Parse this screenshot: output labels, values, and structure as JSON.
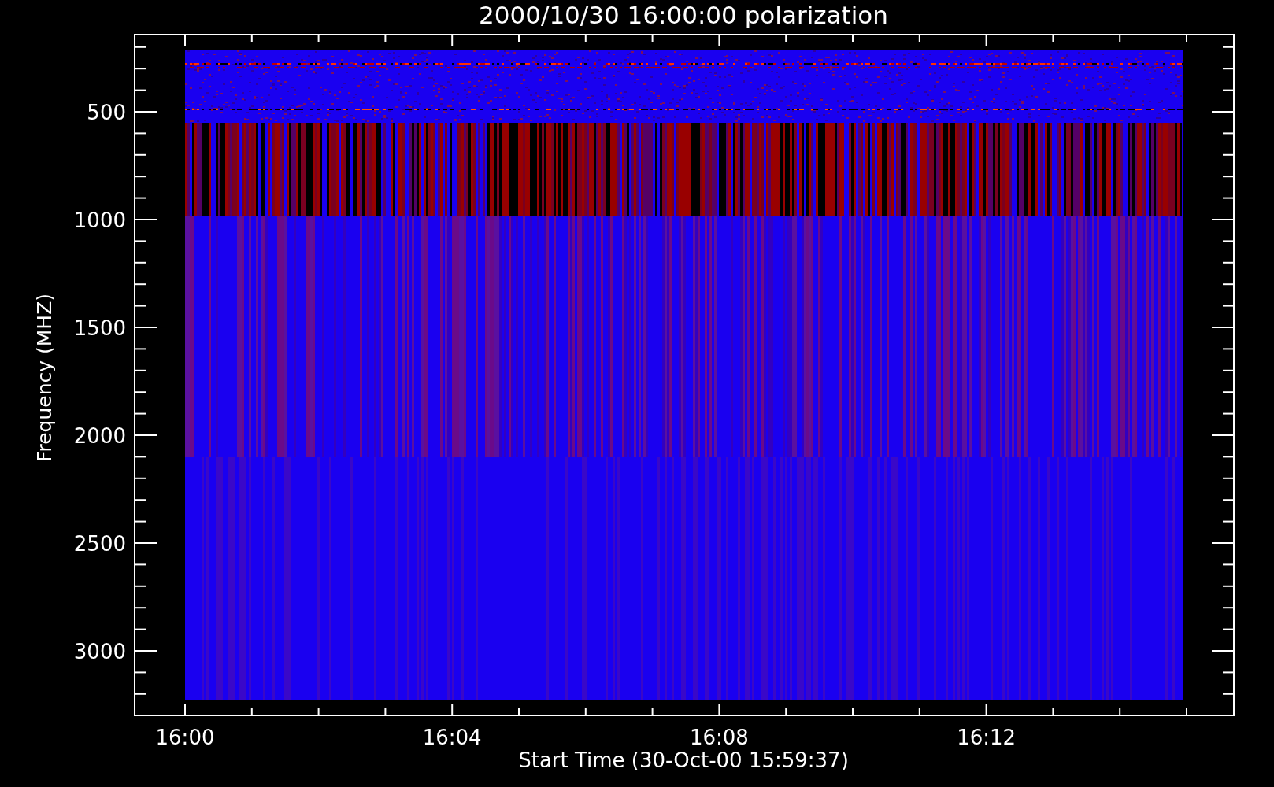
{
  "plot": {
    "title": "2000/10/30 16:00:00 polarization",
    "x_axis": {
      "label": "Start Time (30-Oct-00 15:59:37)",
      "tick_labels": [
        "16:00",
        "16:04",
        "16:08",
        "16:12"
      ]
    },
    "y_axis": {
      "label": "Frequency (MHZ)",
      "tick_labels": [
        "500",
        "1000",
        "1500",
        "2000",
        "2500",
        "3000"
      ]
    }
  }
}
